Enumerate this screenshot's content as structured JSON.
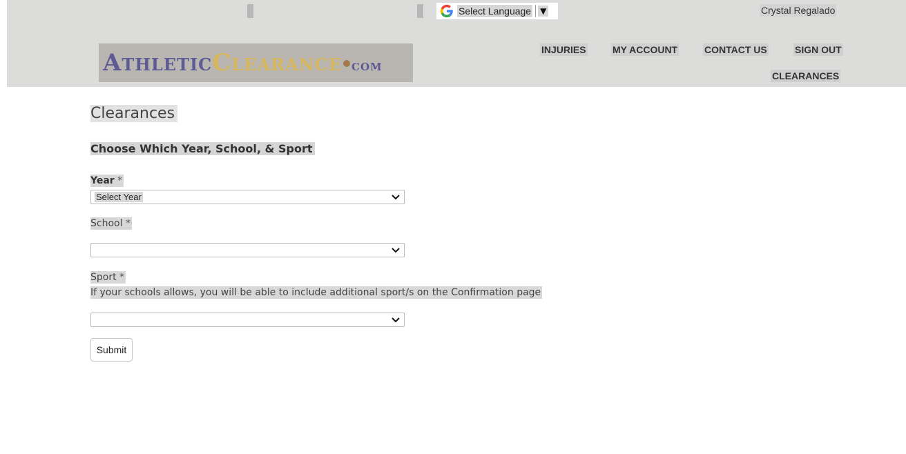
{
  "header": {
    "translate": {
      "label": "Select Language",
      "arrow": "▼",
      "icon": "google-g-icon"
    },
    "user_name": "Crystal Regalado",
    "logo": {
      "part1": "Athletic",
      "part2": "Clearance",
      "part3": "com"
    },
    "nav": {
      "injuries": "INJURIES",
      "my_account": "MY ACCOUNT",
      "contact_us": "CONTACT US",
      "sign_out": "SIGN OUT",
      "clearances": "CLEARANCES"
    }
  },
  "main": {
    "page_title": "Clearances",
    "section_title": "Choose Which Year, School, & Sport",
    "year": {
      "label": "Year",
      "required": "*",
      "value": "Select Year"
    },
    "school": {
      "label": "School",
      "required": "*",
      "value": ""
    },
    "sport": {
      "label": "Sport",
      "required": "*",
      "helper": "If your schools allows, you will be able to include additional sport/s on the Confirmation page",
      "value": ""
    },
    "submit_label": "Submit"
  },
  "colors": {
    "header_bg": "#dcdcdb",
    "logo_purple": "#5d5a94",
    "logo_gold": "#d6b65c"
  }
}
